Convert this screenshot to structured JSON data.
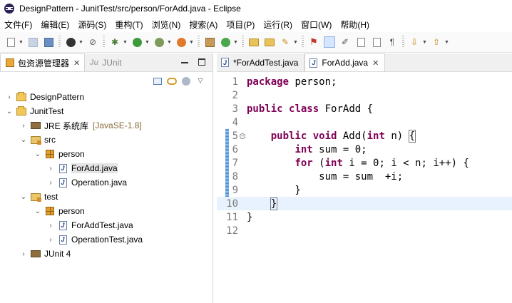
{
  "window": {
    "title": "DesignPattern - JunitTest/src/person/ForAdd.java - Eclipse",
    "app_icon": "eclipse-icon"
  },
  "menubar": {
    "items": [
      "文件(F)",
      "编辑(E)",
      "源码(S)",
      "重构(T)",
      "浏览(N)",
      "搜索(A)",
      "项目(P)",
      "运行(R)",
      "窗口(W)",
      "帮助(H)"
    ]
  },
  "package_explorer": {
    "tab_label": "包资源管理器",
    "close": "✕",
    "junit_tab_label": "JUnit",
    "tree": [
      {
        "label": "DesignPattern",
        "icon": "project-icon",
        "expanded": false
      },
      {
        "label": "JunitTest",
        "icon": "project-icon",
        "expanded": true
      },
      {
        "label": "JRE 系统库",
        "tag": "[JavaSE-1.8]",
        "icon": "library-icon",
        "expanded": false
      },
      {
        "label": "src",
        "icon": "source-folder-icon",
        "expanded": true
      },
      {
        "label": "person",
        "icon": "package-icon",
        "expanded": true
      },
      {
        "label": "ForAdd.java",
        "icon": "java-file-icon",
        "expanded": false,
        "selected": true
      },
      {
        "label": "Operation.java",
        "icon": "java-file-icon",
        "expanded": false
      },
      {
        "label": "test",
        "icon": "source-folder-icon",
        "expanded": true
      },
      {
        "label": "person",
        "icon": "package-icon",
        "expanded": true
      },
      {
        "label": "ForAddTest.java",
        "icon": "java-file-icon",
        "expanded": false
      },
      {
        "label": "OperationTest.java",
        "icon": "java-file-icon",
        "expanded": false
      },
      {
        "label": "JUnit 4",
        "icon": "library-icon",
        "expanded": false
      }
    ]
  },
  "editor": {
    "tabs": [
      {
        "label": "*ForAddTest.java",
        "active": false
      },
      {
        "label": "ForAdd.java",
        "active": true,
        "close": "✕"
      }
    ],
    "lines": [
      {
        "n": "1",
        "text": "package person;"
      },
      {
        "n": "2",
        "text": ""
      },
      {
        "n": "3",
        "text": "public class ForAdd {"
      },
      {
        "n": "4",
        "text": ""
      },
      {
        "n": "5",
        "text": "    public void Add(int n) {"
      },
      {
        "n": "6",
        "text": "        int sum = 0;"
      },
      {
        "n": "7",
        "text": "        for (int i = 0; i < n; i++) {"
      },
      {
        "n": "8",
        "text": "            sum = sum  +i;"
      },
      {
        "n": "9",
        "text": "        }"
      },
      {
        "n": "10",
        "text": "    }"
      },
      {
        "n": "11",
        "text": "}"
      },
      {
        "n": "12",
        "text": ""
      }
    ],
    "keyword_color": "#7f0055",
    "current_line_color": "#e8f2fe"
  }
}
